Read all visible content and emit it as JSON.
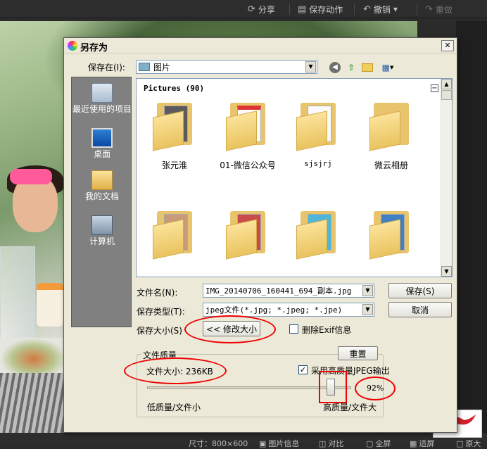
{
  "toolbar": {
    "share_label": "分享",
    "save_action_label": "保存动作",
    "undo_label": "撤销",
    "redo_label": "重做"
  },
  "bottom_bar": {
    "size_label": "尺寸：800×600",
    "image_info_label": "图片信息",
    "compare_label": "对比",
    "fullscreen_label": "全屏",
    "fit_label": "适屏",
    "original_label": "原大"
  },
  "dialog": {
    "title": "另存为",
    "save_in_label": "保存在(I):",
    "save_in_value": "图片",
    "places": [
      {
        "label": "最近使用的项目",
        "icon": "recent-icon"
      },
      {
        "label": "桌面",
        "icon": "desktop-icon"
      },
      {
        "label": "我的文档",
        "icon": "my-documents-icon"
      },
      {
        "label": "计算机",
        "icon": "computer-icon"
      }
    ],
    "file_list": {
      "header": "Pictures (90)",
      "folders": [
        {
          "name": "张元淮",
          "mono": false
        },
        {
          "name": "01-微信公众号",
          "mono": false
        },
        {
          "name": "sjsjrj",
          "mono": true
        },
        {
          "name": "微云相册",
          "mono": false
        },
        {
          "name": "",
          "mono": false
        },
        {
          "name": "",
          "mono": false
        },
        {
          "name": "",
          "mono": false
        },
        {
          "name": "",
          "mono": false
        }
      ]
    },
    "filename_label": "文件名(N):",
    "filename_value": "IMG_20140706_160441_694_副本.jpg",
    "filetype_label": "保存类型(T):",
    "filetype_value": "jpeg文件(*.jpg; *.jpeg; *.jpe)",
    "save_size_label": "保存大小(S)",
    "resize_button": "<< 修改大小",
    "delete_exif_label": "删除Exif信息",
    "delete_exif_checked": false,
    "save_button": "保存(S)",
    "cancel_button": "取消",
    "quality_group_title": "文件质量",
    "reset_button": "重置",
    "file_size_label": "文件大小: 236KB",
    "hq_jpeg_label": "采用高质量JPEG输出",
    "hq_jpeg_checked": true,
    "quality_percent": "92%",
    "quality_value": 0.92,
    "low_quality_label": "低质量/文件小",
    "high_quality_label": "高质量/文件大"
  }
}
